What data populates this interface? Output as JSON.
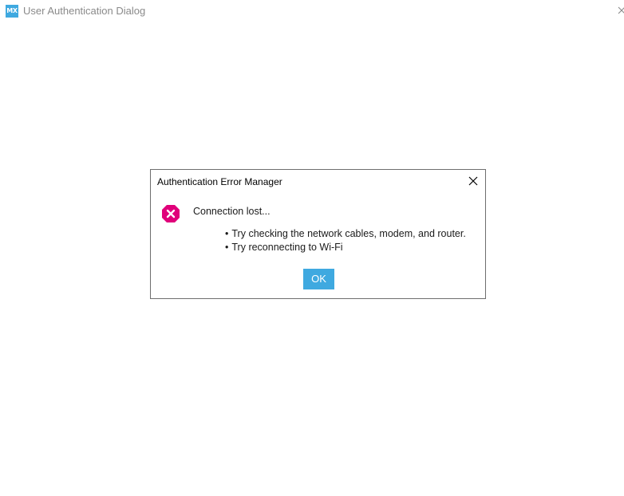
{
  "window": {
    "logo_text": "MX",
    "title": "User Authentication Dialog"
  },
  "dialog": {
    "title": "Authentication Error Manager",
    "message": "Connection lost...",
    "tips": [
      "Try checking the network cables, modem, and router.",
      "Try reconnecting to Wi-Fi"
    ],
    "ok_label": "OK",
    "icon": "error-x-icon"
  },
  "colors": {
    "accent": "#3fa9e0",
    "error": "#e0007a",
    "border": "#6e6e6e",
    "title_gray": "#8a8a8a"
  }
}
